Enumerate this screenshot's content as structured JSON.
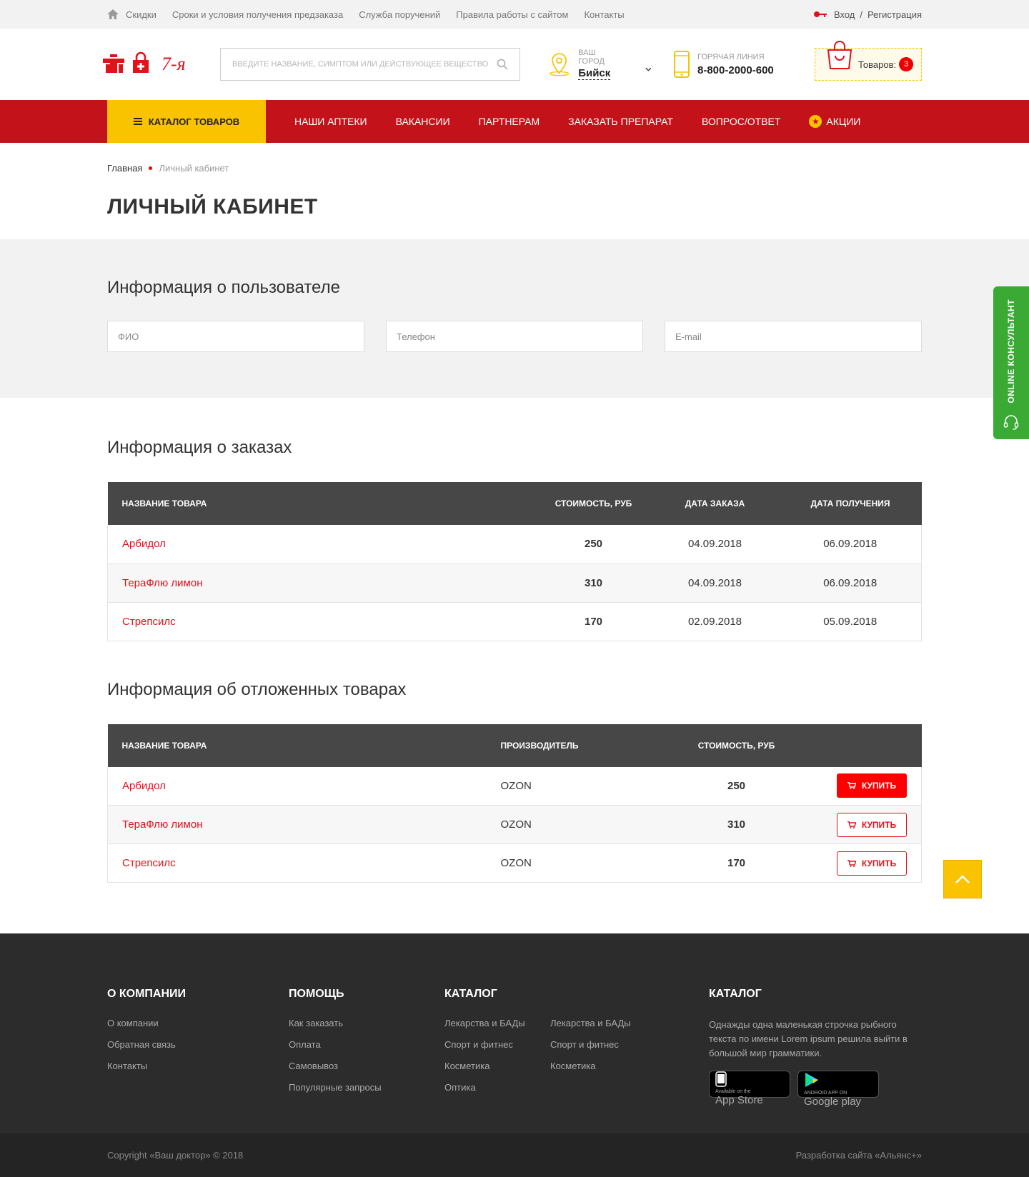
{
  "topbar": {
    "links": [
      "Скидки",
      "Сроки и условия получения предзаказа",
      "Служба поручений",
      "Правила работы с сайтом",
      "Контакты"
    ],
    "login": "Вход",
    "separator": "/",
    "register": "Регистрация"
  },
  "header": {
    "search_placeholder": "Введите название, симптом или действующее вещество",
    "city_label": "Ваш город",
    "city_value": "Бийск",
    "phone_label": "Горячая линия",
    "phone_value": "8-800-2000-600",
    "cart_label": "Товаров:",
    "cart_count": "3"
  },
  "nav": {
    "catalog": "Каталог товаров",
    "items": [
      "Наши аптеки",
      "Вакансии",
      "Партнерам",
      "Заказать препарат",
      "Вопрос/ответ",
      "Акции"
    ]
  },
  "breadcrumb": {
    "home": "Главная",
    "current": "Личный кабинет"
  },
  "page_title": "Личный кабинет",
  "user_info": {
    "title": "Информация о пользователе",
    "fio_placeholder": "ФИО",
    "phone_placeholder": "Телефон",
    "email_placeholder": "E-mail"
  },
  "orders": {
    "title": "Информация о заказах",
    "columns": [
      "Название товара",
      "Стоимость, руб",
      "Дата заказа",
      "Дата получения"
    ],
    "rows": [
      {
        "name": "Арбидол",
        "price": "250",
        "ordered": "04.09.2018",
        "received": "06.09.2018"
      },
      {
        "name": "ТераФлю лимон",
        "price": "310",
        "ordered": "04.09.2018",
        "received": "06.09.2018"
      },
      {
        "name": "Стрепсилс",
        "price": "170",
        "ordered": "02.09.2018",
        "received": "05.09.2018"
      }
    ]
  },
  "deferred": {
    "title": "Информация об отложенных товарах",
    "columns": [
      "Название товара",
      "Производитель",
      "Стоимость, руб"
    ],
    "buy_label": "Купить",
    "rows": [
      {
        "name": "Арбидол",
        "maker": "OZON",
        "price": "250"
      },
      {
        "name": "ТераФлю лимон",
        "maker": "OZON",
        "price": "310"
      },
      {
        "name": "Стрепсилс",
        "maker": "OZON",
        "price": "170"
      }
    ]
  },
  "footer": {
    "col1": {
      "title": "О компании",
      "links": [
        "О компании",
        "Обратная связь",
        "Контакты"
      ]
    },
    "col2": {
      "title": "Помощь",
      "links": [
        "Как заказать",
        "Оплата",
        "Самовывоз",
        "Популярные запросы"
      ]
    },
    "col3": {
      "title": "Каталог",
      "links_a": [
        "Лекарства и БАДы",
        "Спорт и фитнес",
        "Косметика",
        "Оптика"
      ],
      "links_b": [
        "Лекарства и БАДы",
        "Спорт и фитнес",
        "Косметика"
      ]
    },
    "col4": {
      "title": "Каталог",
      "text": "Однажды одна маленькая строчка рыбного текста по имени Lorem ipsum решила выйти в большой мир грамматики."
    },
    "appstore_small": "Available on the",
    "appstore_big": "App Store",
    "gplay_small": "ANDROID APP ON",
    "gplay_big": "Google play",
    "copyright": "Copyright «Ваш доктор» © 2018",
    "developer": "Разработка сайта «Альянс+»"
  },
  "online_consultant": "Online консультант",
  "colors": {
    "accent_red": "#c4121a",
    "accent_yellow": "#f9c300",
    "link_red": "#e0121a",
    "green": "#3aaa35"
  },
  "icons": [
    "home-icon",
    "key-icon",
    "search-icon",
    "location-icon",
    "phone-icon",
    "bag-icon",
    "menu-icon",
    "star-icon",
    "cart-icon",
    "headset-icon",
    "arrow-up-icon"
  ]
}
